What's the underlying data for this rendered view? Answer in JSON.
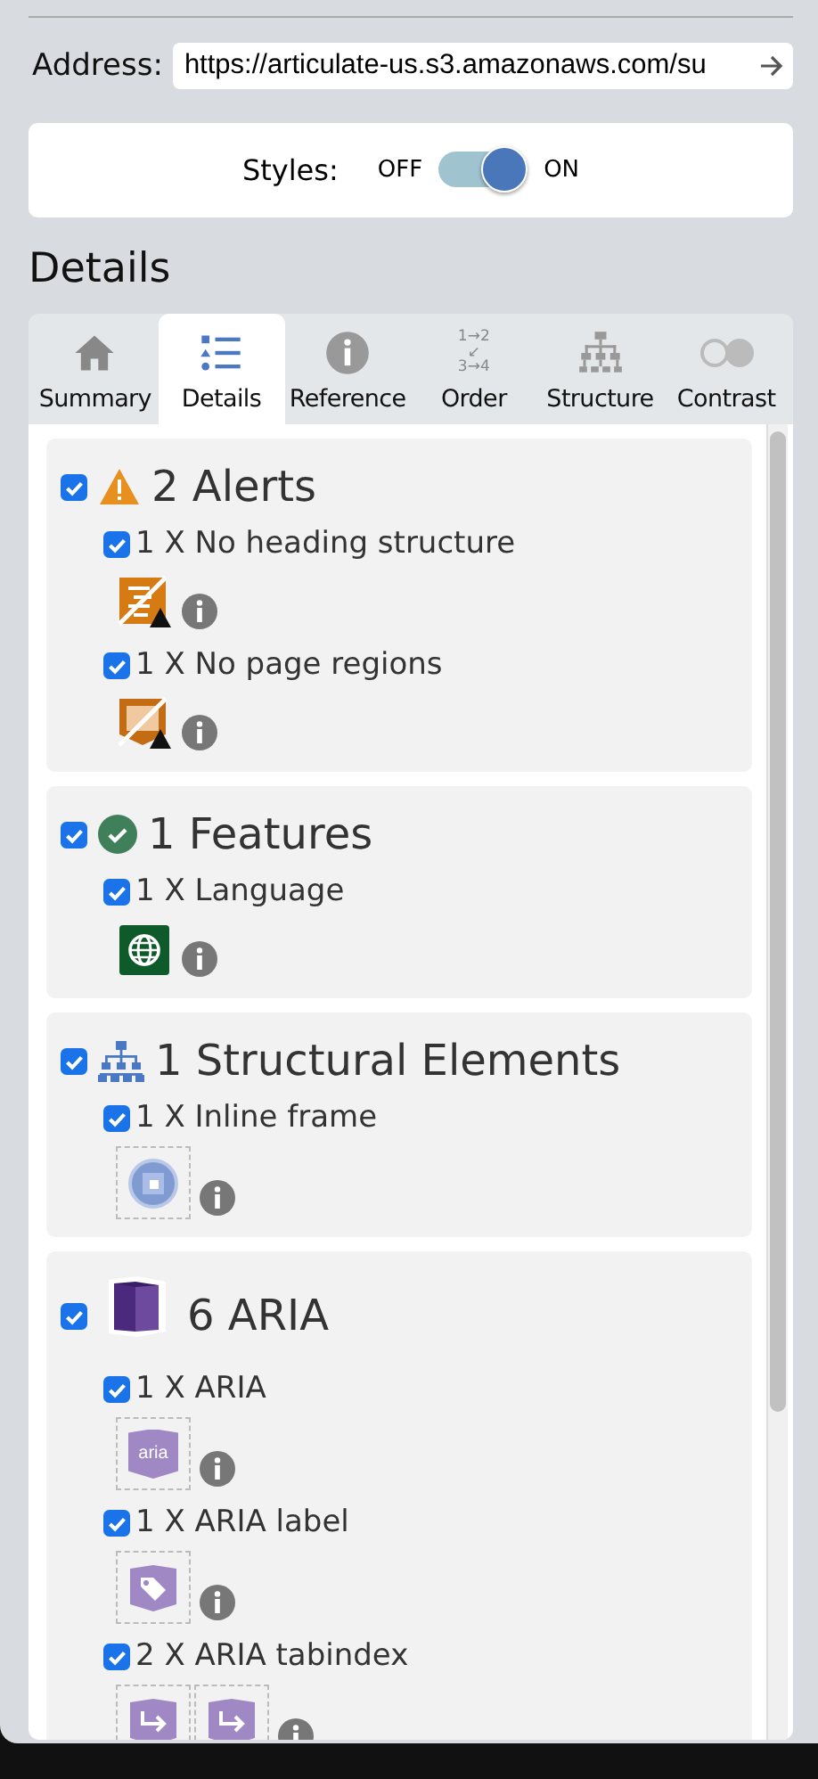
{
  "address": {
    "label": "Address:",
    "value": "https://articulate-us.s3.amazonaws.com/su"
  },
  "styles": {
    "label": "Styles:",
    "off_label": "OFF",
    "on_label": "ON",
    "on": true
  },
  "section_title": "Details",
  "tabs": [
    {
      "label": "Summary",
      "kind": "home",
      "selected": false
    },
    {
      "label": "Details",
      "kind": "list",
      "selected": true
    },
    {
      "label": "Reference",
      "kind": "info",
      "selected": false
    },
    {
      "label": "Order",
      "kind": "order",
      "icon_text": [
        "1→2",
        "↙",
        "3→4"
      ],
      "selected": false
    },
    {
      "label": "Structure",
      "kind": "tree",
      "selected": false
    },
    {
      "label": "Contrast",
      "kind": "contrast",
      "selected": false
    }
  ],
  "groups": [
    {
      "title": "2 Alerts",
      "kind": "alert",
      "checked": true,
      "items": [
        {
          "label": "1 X No heading structure",
          "checked": true,
          "icons": [
            {
              "kind": "no-heading"
            }
          ]
        },
        {
          "label": "1 X No page regions",
          "checked": true,
          "icons": [
            {
              "kind": "no-regions"
            }
          ]
        }
      ]
    },
    {
      "title": "1 Features",
      "kind": "feature",
      "checked": true,
      "items": [
        {
          "label": "1 X Language",
          "checked": true,
          "icons": [
            {
              "kind": "language"
            }
          ]
        }
      ]
    },
    {
      "title": "1 Structural Elements",
      "kind": "structure",
      "checked": true,
      "items": [
        {
          "label": "1 X Inline frame",
          "checked": true,
          "icons": [
            {
              "kind": "iframe"
            }
          ]
        }
      ]
    },
    {
      "title": "6 ARIA",
      "kind": "aria",
      "checked": true,
      "items": [
        {
          "label": "1 X ARIA",
          "checked": true,
          "icons": [
            {
              "kind": "aria",
              "text": "aria"
            }
          ]
        },
        {
          "label": "1 X ARIA label",
          "checked": true,
          "icons": [
            {
              "kind": "aria-label"
            }
          ]
        },
        {
          "label": "2 X ARIA tabindex",
          "checked": true,
          "icons": [
            {
              "kind": "aria-tabindex"
            },
            {
              "kind": "aria-tabindex"
            }
          ]
        }
      ]
    }
  ]
}
